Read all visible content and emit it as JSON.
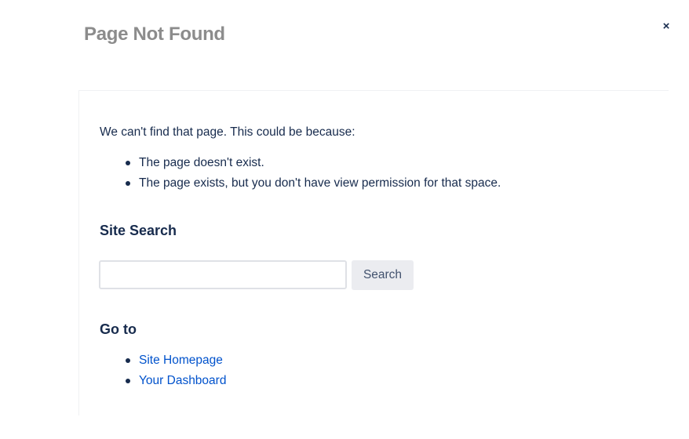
{
  "dialog": {
    "close_symbol": "×",
    "title": "Page Not Found"
  },
  "content": {
    "intro": "We can't find that page. This could be because:",
    "reasons": [
      "The page doesn't exist.",
      "The page exists, but you don't have view permission for that space."
    ]
  },
  "search": {
    "heading": "Site Search",
    "input_value": "",
    "placeholder": "",
    "button_label": "Search"
  },
  "goto": {
    "heading": "Go to",
    "links": [
      "Site Homepage",
      "Your Dashboard"
    ]
  },
  "icons": {
    "close": "close-icon"
  },
  "colors": {
    "title": "#8c8c8c",
    "text": "#172b4d",
    "link": "#0052cc",
    "button_bg": "#ebecf0",
    "input_border": "#dfe1e6"
  }
}
